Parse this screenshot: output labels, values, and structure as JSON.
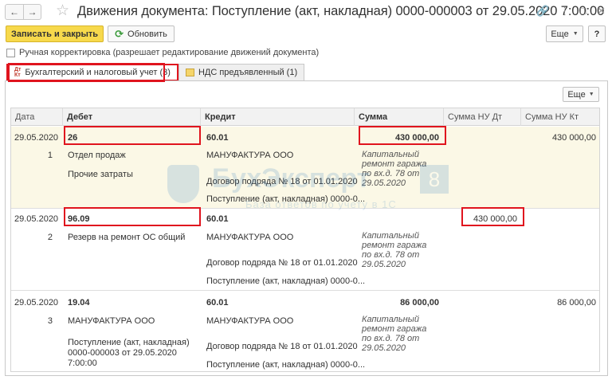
{
  "window": {
    "title": "Движения документа: Поступление (акт, накладная) 0000-000003 от 29.05.2020 7:00:00"
  },
  "toolbar": {
    "save_close_label": "Записать и закрыть",
    "refresh_label": "Обновить",
    "more_label": "Еще",
    "help_label": "?"
  },
  "manual_adjustment": {
    "label": "Ручная корректировка (разрешает редактирование движений документа)",
    "checked": false
  },
  "tabs": [
    {
      "label": "Бухгалтерский и налоговый учет (3)",
      "icon": "dt-kt-icon",
      "active": true
    },
    {
      "label": "НДС предъявленный (1)",
      "icon": "nds-icon",
      "active": false
    }
  ],
  "grid": {
    "more_label": "Еще",
    "columns": [
      "Дата",
      "Дебет",
      "Кредит",
      "Сумма",
      "Сумма НУ Дт",
      "Сумма НУ Кт"
    ],
    "rows": [
      {
        "date": "29.05.2020",
        "num": "1",
        "debit_account": "26",
        "debit_sub1": "Отдел продаж",
        "debit_sub2": "Прочие затраты",
        "credit_account": "60.01",
        "credit_sub1": "МАНУФАКТУРА ООО",
        "credit_sub2": "Договор подряда № 18 от 01.01.2020",
        "credit_sub3": "Поступление (акт, накладная) 0000-0...",
        "amount": "430 000,00",
        "comment": "Капитальный ремонт гаража по вх.д. 78 от 29.05.2020",
        "nu_dt": "",
        "nu_kt": "430 000,00"
      },
      {
        "date": "29.05.2020",
        "num": "2",
        "debit_account": "96.09",
        "debit_sub1": "Резерв на ремонт ОС общий",
        "debit_sub2": "",
        "credit_account": "60.01",
        "credit_sub1": "МАНУФАКТУРА ООО",
        "credit_sub2": "Договор подряда № 18 от 01.01.2020",
        "credit_sub3": "Поступление (акт, накладная) 0000-0...",
        "amount": "",
        "comment": "Капитальный ремонт гаража по вх.д. 78 от 29.05.2020",
        "nu_dt": "430 000,00",
        "nu_kt": ""
      },
      {
        "date": "29.05.2020",
        "num": "3",
        "debit_account": "19.04",
        "debit_sub1": "МАНУФАКТУРА ООО",
        "debit_sub2": "Поступление (акт, накладная) 0000-000003 от 29.05.2020 7:00:00",
        "credit_account": "60.01",
        "credit_sub1": "МАНУФАКТУРА ООО",
        "credit_sub2": "Договор подряда № 18 от 01.01.2020",
        "credit_sub3": "Поступление (акт, накладная) 0000-0...",
        "amount": "86 000,00",
        "comment": "Капитальный ремонт гаража по вх.д. 78 от 29.05.2020",
        "nu_dt": "",
        "nu_kt": "86 000,00"
      }
    ]
  },
  "watermark": {
    "brand": "БухЭксперт",
    "badge": "8",
    "tagline": "База ответов по учету в 1С"
  },
  "colors": {
    "primary_button": "#f7d94c",
    "highlight": "#e0141e",
    "selected_row": "#fbf8e6"
  }
}
